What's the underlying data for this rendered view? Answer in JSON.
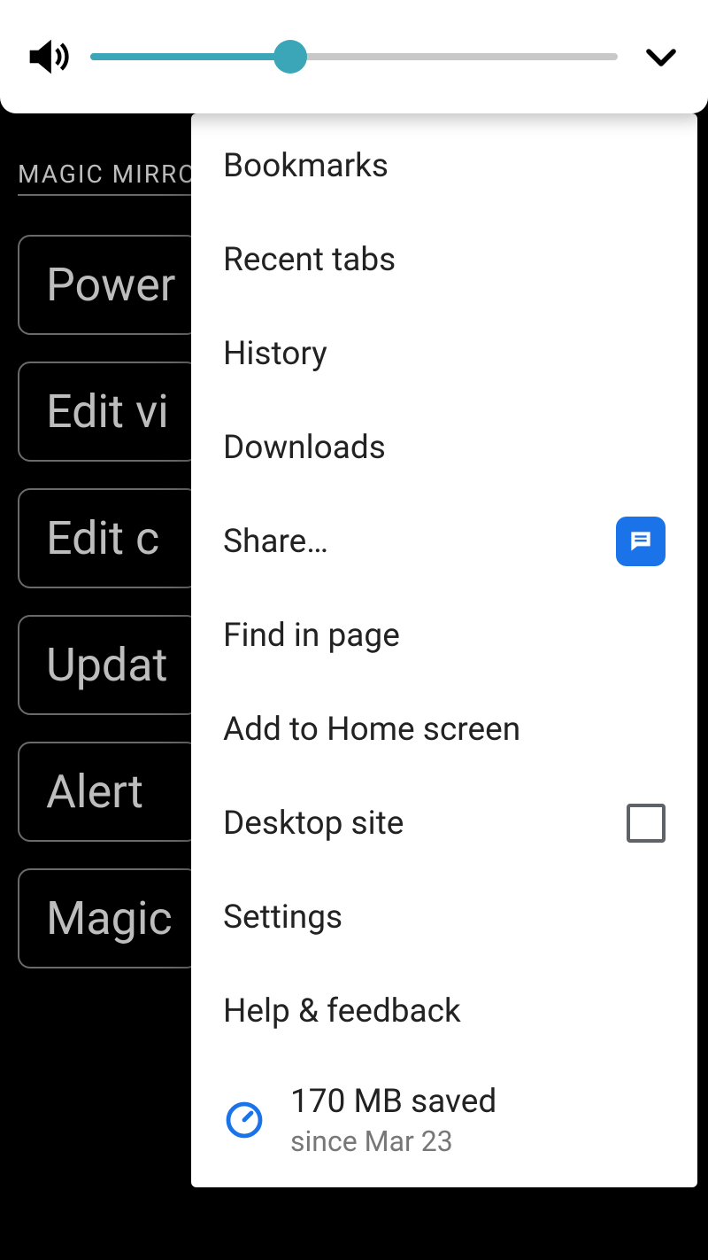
{
  "volume": {
    "percent": 38
  },
  "background": {
    "heading": "MAGIC MIRROR",
    "buttons": [
      "Power",
      "Edit vi",
      "Edit c",
      "Updat",
      "Alert",
      "Magic"
    ]
  },
  "menu": {
    "bookmarks": "Bookmarks",
    "recent_tabs": "Recent tabs",
    "history": "History",
    "downloads": "Downloads",
    "share": "Share…",
    "find_in_page": "Find in page",
    "add_to_home": "Add to Home screen",
    "desktop_site": "Desktop site",
    "settings": "Settings",
    "help": "Help & feedback",
    "data_saver": {
      "main": "170 MB saved",
      "sub": "since Mar 23"
    }
  }
}
